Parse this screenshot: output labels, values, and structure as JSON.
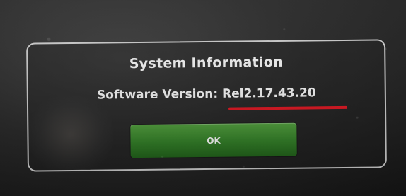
{
  "dialog": {
    "title": "System Information",
    "version_label": "Software Version:",
    "version_value": "Rel2.17.43.20",
    "ok_label": "OK"
  },
  "colors": {
    "underline": "#d9141f",
    "button": "#2f7a24",
    "text": "#efefef"
  }
}
